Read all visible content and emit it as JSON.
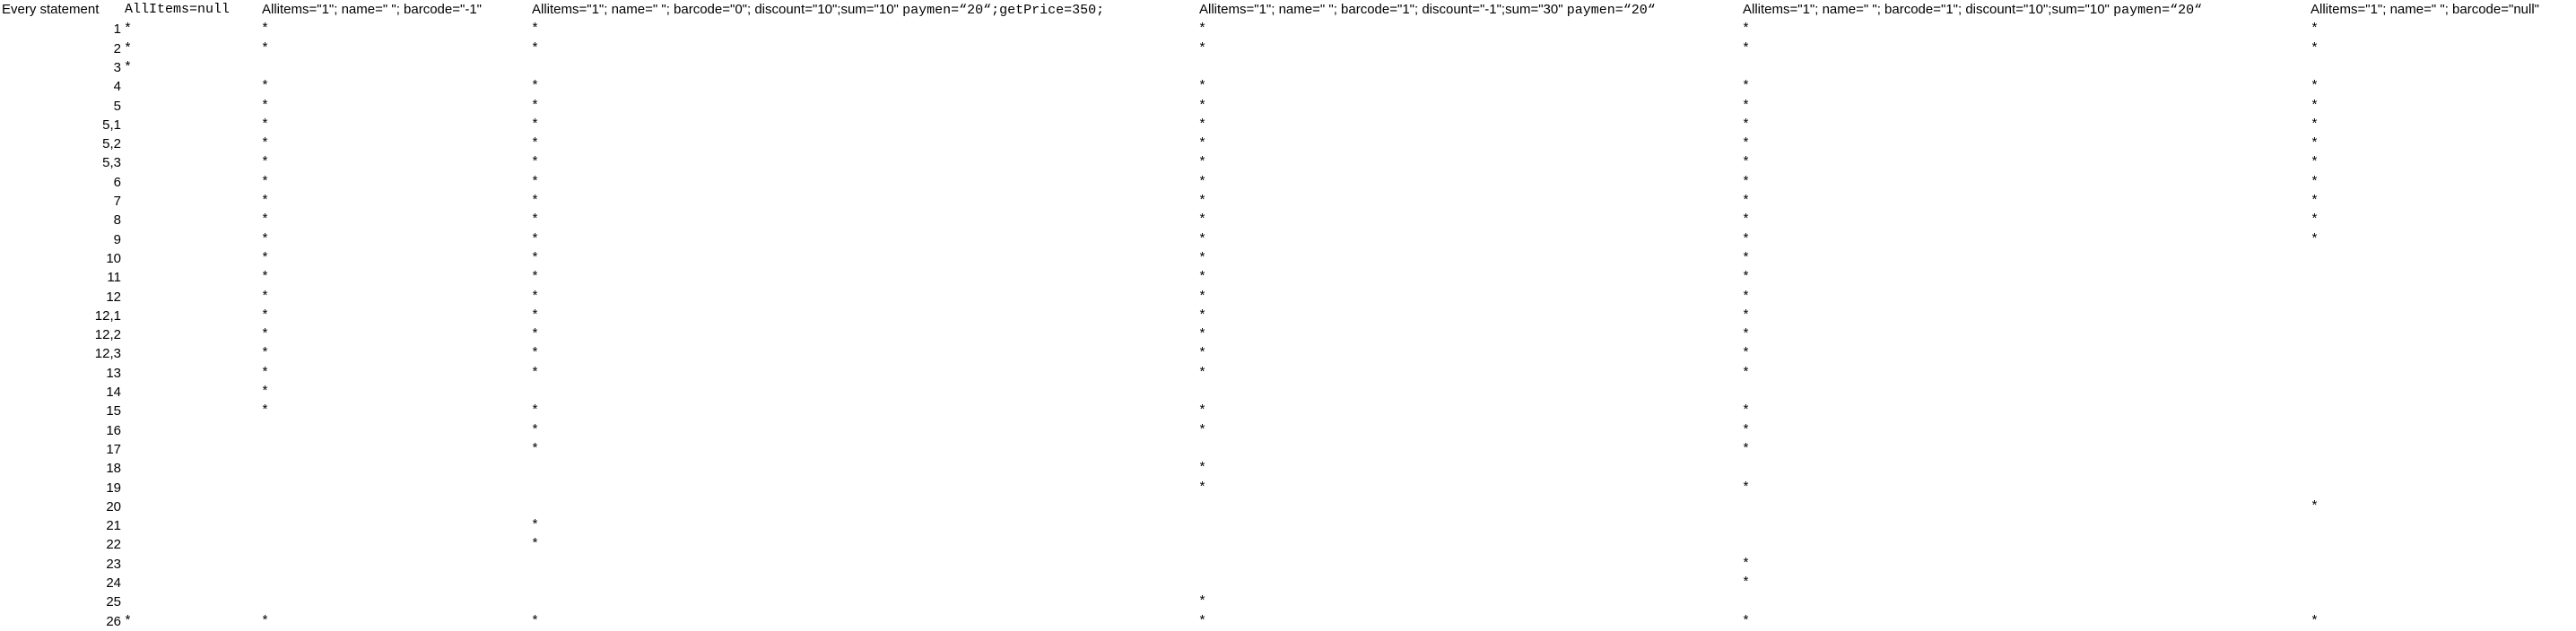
{
  "header": {
    "every_statement": "Every statement",
    "col0": "AllItems=null",
    "col1": "Allitems=\"1\"; name=\" \"; barcode=\"-1\"",
    "col2_a": "Allitems=\"1\"; name=\" \"; barcode=\"0\"; discount=\"10\";sum=\"10\"",
    "col2_b": "paymen=“20“;getPrice=350;",
    "col3_a": "Allitems=\"1\"; name=\" \"; barcode=\"1\"; discount=\"-1\";sum=\"30\"",
    "col3_b": "paymen=“20“",
    "col4_a": "Allitems=\"1\"; name=\" \"; barcode=\"1\"; discount=\"10\";sum=\"10\"",
    "col4_b": "paymen=“20“",
    "col5": "Allitems=\"1\"; name=\" \"; barcode=\"null\""
  },
  "mark_symbol": "*",
  "rows": [
    {
      "label": "1",
      "star": "*",
      "c1": "*",
      "c2": "*",
      "c3": "*",
      "c4": "*",
      "c5": "*"
    },
    {
      "label": "2",
      "star": "*",
      "c1": "*",
      "c2": "*",
      "c3": "*",
      "c4": "*",
      "c5": "*"
    },
    {
      "label": "3",
      "star": "*",
      "c1": "",
      "c2": "",
      "c3": "",
      "c4": "",
      "c5": ""
    },
    {
      "label": "4",
      "star": "",
      "c1": "*",
      "c2": "*",
      "c3": "*",
      "c4": "*",
      "c5": "*"
    },
    {
      "label": "5",
      "star": "",
      "c1": "*",
      "c2": "*",
      "c3": "*",
      "c4": "*",
      "c5": "*"
    },
    {
      "label": "5,1",
      "star": "",
      "c1": "*",
      "c2": "*",
      "c3": "*",
      "c4": "*",
      "c5": "*"
    },
    {
      "label": "5,2",
      "star": "",
      "c1": "*",
      "c2": "*",
      "c3": "*",
      "c4": "*",
      "c5": "*"
    },
    {
      "label": "5,3",
      "star": "",
      "c1": "*",
      "c2": "*",
      "c3": "*",
      "c4": "*",
      "c5": "*"
    },
    {
      "label": "6",
      "star": "",
      "c1": "*",
      "c2": "*",
      "c3": "*",
      "c4": "*",
      "c5": "*"
    },
    {
      "label": "7",
      "star": "",
      "c1": "*",
      "c2": "*",
      "c3": "*",
      "c4": "*",
      "c5": "*"
    },
    {
      "label": "8",
      "star": "",
      "c1": "*",
      "c2": "*",
      "c3": "*",
      "c4": "*",
      "c5": "*"
    },
    {
      "label": "9",
      "star": "",
      "c1": "*",
      "c2": "*",
      "c3": "*",
      "c4": "*",
      "c5": "*"
    },
    {
      "label": "10",
      "star": "",
      "c1": "*",
      "c2": "*",
      "c3": "*",
      "c4": "*",
      "c5": ""
    },
    {
      "label": "11",
      "star": "",
      "c1": "*",
      "c2": "*",
      "c3": "*",
      "c4": "*",
      "c5": ""
    },
    {
      "label": "12",
      "star": "",
      "c1": "*",
      "c2": "*",
      "c3": "*",
      "c4": "*",
      "c5": ""
    },
    {
      "label": "12,1",
      "star": "",
      "c1": "*",
      "c2": "*",
      "c3": "*",
      "c4": "*",
      "c5": ""
    },
    {
      "label": "12,2",
      "star": "",
      "c1": "*",
      "c2": "*",
      "c3": "*",
      "c4": "*",
      "c5": ""
    },
    {
      "label": "12,3",
      "star": "",
      "c1": "*",
      "c2": "*",
      "c3": "*",
      "c4": "*",
      "c5": ""
    },
    {
      "label": "13",
      "star": "",
      "c1": "*",
      "c2": "*",
      "c3": "*",
      "c4": "*",
      "c5": ""
    },
    {
      "label": "14",
      "star": "",
      "c1": "*",
      "c2": "",
      "c3": "",
      "c4": "",
      "c5": ""
    },
    {
      "label": "15",
      "star": "",
      "c1": "*",
      "c2": "*",
      "c3": "*",
      "c4": "*",
      "c5": ""
    },
    {
      "label": "16",
      "star": "",
      "c1": "",
      "c2": "*",
      "c3": "*",
      "c4": "*",
      "c5": ""
    },
    {
      "label": "17",
      "star": "",
      "c1": "",
      "c2": "*",
      "c3": "",
      "c4": "*",
      "c5": ""
    },
    {
      "label": "18",
      "star": "",
      "c1": "",
      "c2": "",
      "c3": "*",
      "c4": "",
      "c5": ""
    },
    {
      "label": "19",
      "star": "",
      "c1": "",
      "c2": "",
      "c3": "*",
      "c4": "*",
      "c5": ""
    },
    {
      "label": "20",
      "star": "",
      "c1": "",
      "c2": "",
      "c3": "",
      "c4": "",
      "c5": "*"
    },
    {
      "label": "21",
      "star": "",
      "c1": "",
      "c2": "*",
      "c3": "",
      "c4": "",
      "c5": ""
    },
    {
      "label": "22",
      "star": "",
      "c1": "",
      "c2": "*",
      "c3": "",
      "c4": "",
      "c5": ""
    },
    {
      "label": "23",
      "star": "",
      "c1": "",
      "c2": "",
      "c3": "",
      "c4": "*",
      "c5": ""
    },
    {
      "label": "24",
      "star": "",
      "c1": "",
      "c2": "",
      "c3": "",
      "c4": "*",
      "c5": ""
    },
    {
      "label": "25",
      "star": "",
      "c1": "",
      "c2": "",
      "c3": "*",
      "c4": "",
      "c5": ""
    },
    {
      "label": "26",
      "star": "*",
      "c1": "*",
      "c2": "*",
      "c3": "*",
      "c4": "*",
      "c5": "*"
    }
  ]
}
